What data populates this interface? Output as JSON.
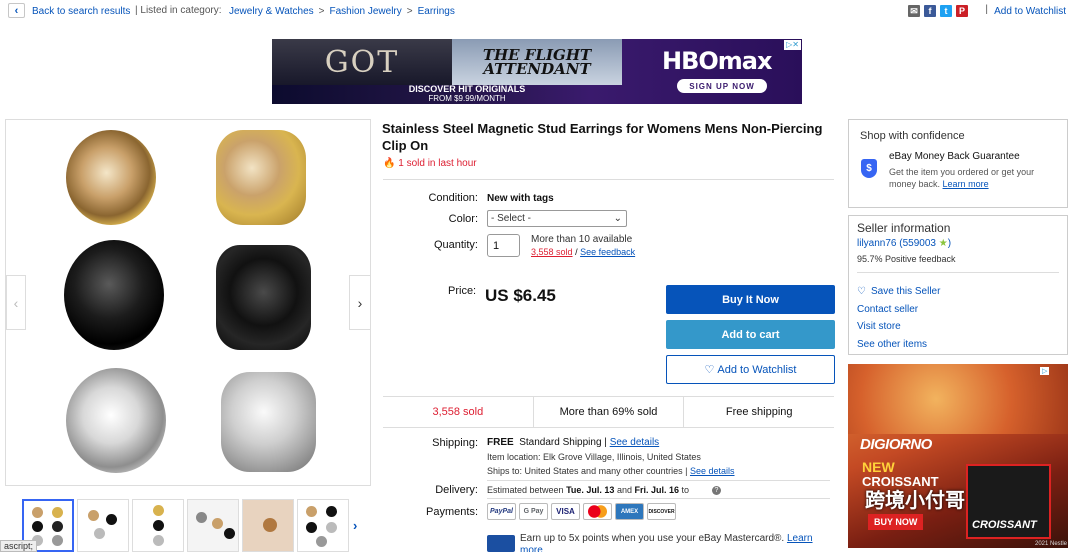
{
  "topbar": {
    "back_label": "Back to search results",
    "listed_prefix": "| Listed in category:",
    "breadcrumbs": [
      "Jewelry & Watches",
      "Fashion Jewelry",
      "Earrings"
    ],
    "breadcrumb_sep": ">",
    "bar": "|",
    "add_watchlist": "Add to Watchlist",
    "share_icons": [
      "email-icon",
      "facebook-icon",
      "twitter-icon",
      "pinterest-icon"
    ]
  },
  "top_ad": {
    "got": "GOT",
    "flight": "THE FLIGHT ATTENDANT",
    "brand": "HBOmax",
    "signup": "SIGN UP NOW",
    "discover": "DISCOVER HIT ORIGINALS",
    "price_line": "FROM $9.99/MONTH"
  },
  "gallery": {
    "prev": "‹",
    "next": "›",
    "thumb_next": "›",
    "descript": "ascript;"
  },
  "product": {
    "title": "Stainless Steel Magnetic Stud Earrings for Womens Mens Non-Piercing Clip On",
    "sold_hour": "1 sold in last hour",
    "condition_label": "Condition:",
    "condition_value": "New with tags",
    "color_label": "Color:",
    "color_selected": "- Select -",
    "quantity_label": "Quantity:",
    "quantity_value": "1",
    "availability": "More than 10 available",
    "sold_count_link": "3,558 sold",
    "feedback_link": "See feedback",
    "slash": "/",
    "price_label": "Price:",
    "price_value": "US $6.45",
    "buy_now": "Buy It Now",
    "add_to_cart": "Add to cart",
    "add_watchlist": "Add to Watchlist"
  },
  "stats": [
    "3,558 sold",
    "More than 69% sold",
    "Free shipping"
  ],
  "shipping": {
    "label": "Shipping:",
    "free": "FREE",
    "method": "Standard Shipping |",
    "see_details": "See details",
    "location": "Item location:  Elk Grove Village, Illinois, United States",
    "ships_to": "Ships to:  United States and many other countries |",
    "ships_to_link": "See details"
  },
  "delivery": {
    "label": "Delivery:",
    "prefix": "Estimated between",
    "start": "Tue. Jul. 13",
    "and": "and",
    "end": "Fri. Jul. 16",
    "suffix": "to"
  },
  "payments": {
    "label": "Payments:",
    "methods": [
      "PayPal",
      "G Pay",
      "VISA",
      "MC",
      "AMEX",
      "DISCOVER"
    ],
    "earn_text": "Earn up to 5x points when you use your eBay Mastercard®.",
    "learn_more": "Learn more"
  },
  "confidence": {
    "title": "Shop with confidence",
    "mbg_title": "eBay Money Back Guarantee",
    "mbg_text": "Get the item you ordered or get your money back.",
    "learn_more": "Learn more"
  },
  "seller": {
    "title": "Seller information",
    "name": "lilyann76",
    "score": "(559003",
    "score_close": ")",
    "star": "★",
    "feedback": "95.7% Positive feedback",
    "save": "Save this Seller",
    "contact": "Contact seller",
    "visit": "Visit store",
    "other": "See other items"
  },
  "side_ad": {
    "brand": "DIGIORNO",
    "new": "NEW",
    "product": "CROISSANT",
    "product2": "CRUST",
    "buy_now": "BUY NOW",
    "box_label": "CROISSANT",
    "watermark": "跨境小付哥",
    "fine": "2021 Nestle"
  },
  "colors": {
    "ebay_blue": "#0654ba",
    "cart_blue": "#3498ca",
    "sold_red": "#dd1e31"
  }
}
